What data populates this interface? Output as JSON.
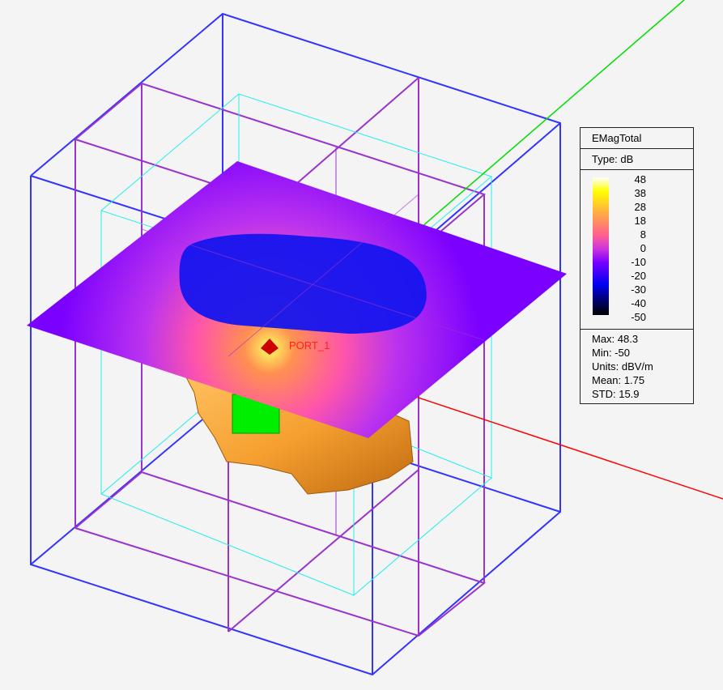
{
  "legend": {
    "title": "EMagTotal",
    "type": "Type: dB",
    "ticks": [
      "48",
      "38",
      "28",
      "18",
      "8",
      "0",
      "-10",
      "-20",
      "-30",
      "-40",
      "-50"
    ],
    "stats": {
      "max": "Max: 48.3",
      "min": "Min: -50",
      "units": "Units: dBV/m",
      "mean": "Mean: 1.75",
      "std": "STD: 15.9"
    }
  },
  "scene": {
    "port_label": "PORT_1",
    "colors": {
      "outer_box": "#3333ff",
      "inner_box": "#9933cc",
      "cyan_box": "#22eeee",
      "x_axis": "#ff0000",
      "y_axis": "#00dd00",
      "head": "#f5a030",
      "block": "#00ee00"
    }
  }
}
